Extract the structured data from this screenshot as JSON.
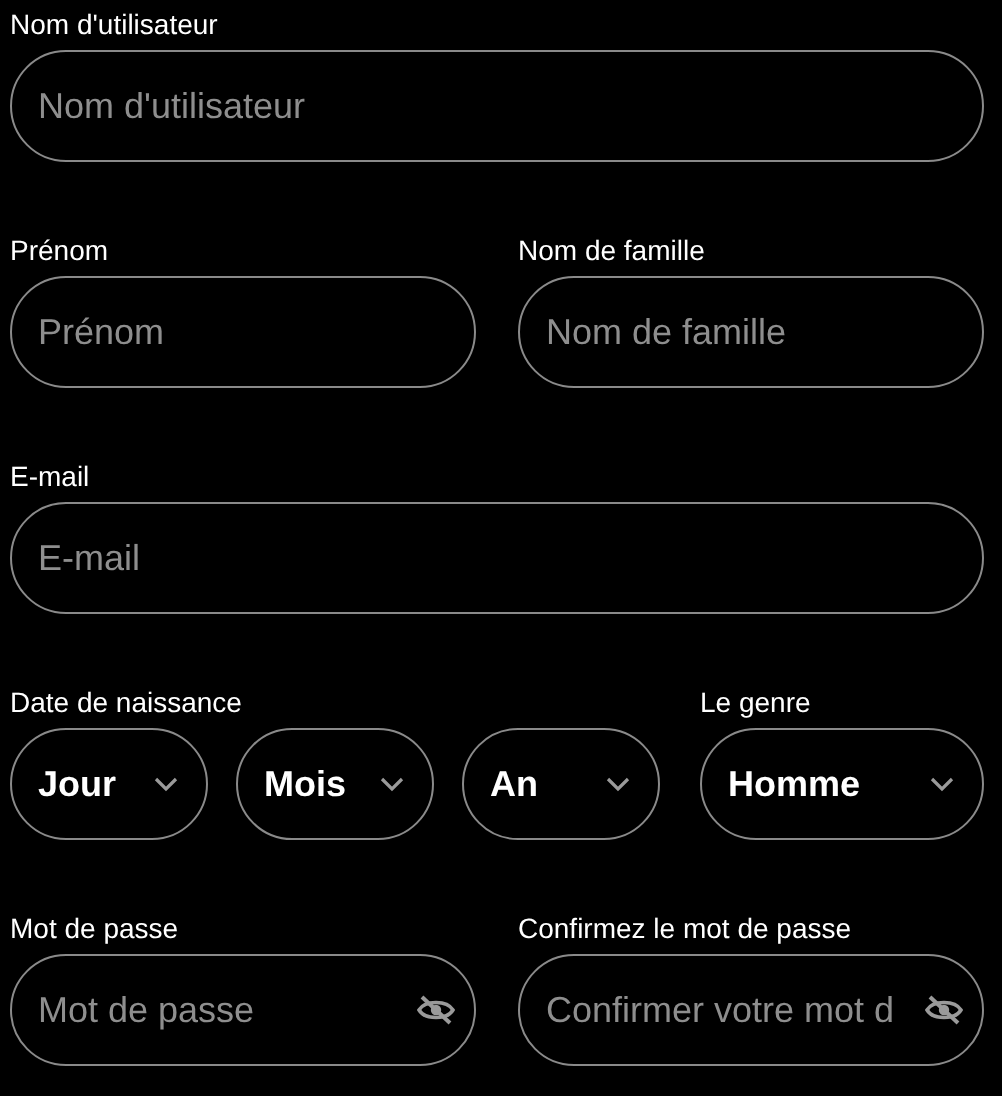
{
  "rows": [
    {
      "fields": [
        {
          "kind": "text",
          "label": "Nom d'utilisateur",
          "placeholder": "Nom d'utilisateur"
        }
      ]
    },
    {
      "fields": [
        {
          "kind": "text",
          "label": "Prénom",
          "placeholder": "Prénom"
        },
        {
          "kind": "text",
          "label": "Nom de famille",
          "placeholder": "Nom de famille"
        }
      ]
    },
    {
      "fields": [
        {
          "kind": "text",
          "label": "E-mail",
          "placeholder": "E-mail"
        }
      ]
    },
    {
      "fields": [
        {
          "kind": "date",
          "label": "Date de naissance",
          "selects": [
            "Jour",
            "Mois",
            "An"
          ]
        },
        {
          "kind": "select",
          "label": "Le genre",
          "value": "Homme"
        }
      ]
    },
    {
      "fields": [
        {
          "kind": "password",
          "label": "Mot de passe",
          "placeholder": "Mot de passe"
        },
        {
          "kind": "password",
          "label": "Confirmez le mot de passe",
          "placeholder": "Confirmer votre mot d"
        }
      ]
    }
  ]
}
